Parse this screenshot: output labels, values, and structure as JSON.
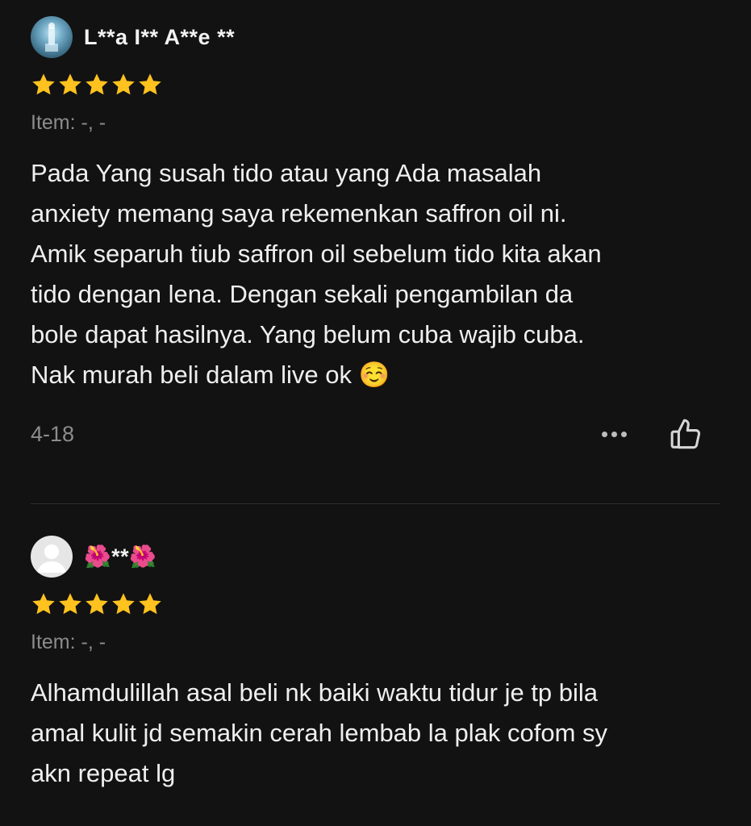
{
  "reviews": [
    {
      "username": "L**a I** A**e **",
      "rating": 5,
      "item": "Item: -, -",
      "text": "Pada Yang susah tido atau yang Ada masalah\nanxiety memang saya rekemenkan saffron oil ni.\nAmik separuh tiub saffron oil sebelum tido kita akan\ntido dengan lena. Dengan sekali pengambilan da\nbole dapat hasilnya. Yang belum cuba wajib cuba.\nNak murah beli dalam live ok ☺️",
      "date": "4-18",
      "more_icon": "more-horizontal-icon",
      "like_icon": "thumbs-up-icon"
    },
    {
      "username": "🌺**🌺",
      "rating": 5,
      "item": "Item: -, -",
      "text": "Alhamdulillah asal beli nk baiki waktu tidur je tp bila\namal kulit jd semakin cerah lembab la plak cofom sy\nakn repeat lg"
    }
  ],
  "colors": {
    "background": "#121212",
    "star": "#ffc21f",
    "text_primary": "#efefef",
    "text_secondary": "#8c8c8c",
    "divider": "#2e2e2e"
  }
}
